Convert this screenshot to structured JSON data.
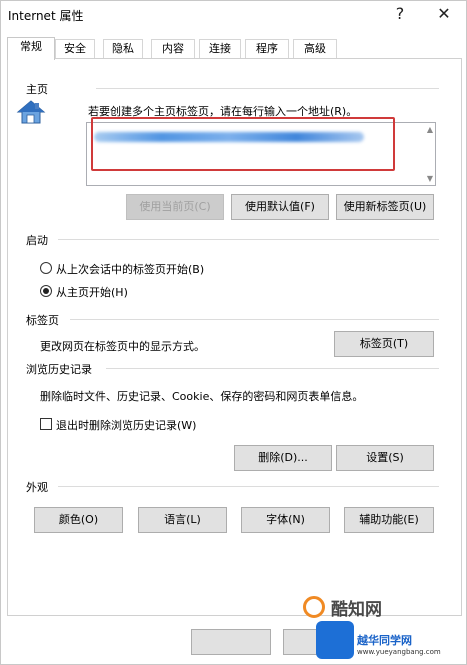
{
  "window": {
    "title": "Internet 属性",
    "help_glyph": "?",
    "close_glyph": "✕"
  },
  "tabs": [
    {
      "label": "常规",
      "active": true
    },
    {
      "label": "安全",
      "active": false
    },
    {
      "label": "隐私",
      "active": false
    },
    {
      "label": "内容",
      "active": false
    },
    {
      "label": "连接",
      "active": false
    },
    {
      "label": "程序",
      "active": false
    },
    {
      "label": "高级",
      "active": false
    }
  ],
  "homepage": {
    "section": "主页",
    "instruction": "若要创建多个主页标签页，请在每行输入一个地址(R)。",
    "use_current": "使用当前页(C)",
    "use_default": "使用默认值(F)",
    "use_new_tab": "使用新标签页(U)"
  },
  "startup": {
    "section": "启动",
    "option_last_session": "从上次会话中的标签页开始(B)",
    "option_home": "从主页开始(H)",
    "selected": "option_home"
  },
  "tabs_section": {
    "section": "标签页",
    "description": "更改网页在标签页中的显示方式。",
    "button": "标签页(T)"
  },
  "history": {
    "section": "浏览历史记录",
    "description": "删除临时文件、历史记录、Cookie、保存的密码和网页表单信息。",
    "checkbox_label": "退出时删除浏览历史记录(W)",
    "checked": false,
    "delete_button": "删除(D)...",
    "settings_button": "设置(S)"
  },
  "appearance": {
    "section": "外观",
    "colors": "颜色(O)",
    "languages": "语言(L)",
    "fonts": "字体(N)",
    "accessibility": "辅助功能(E)"
  },
  "watermark": {
    "brand1": "酷知网",
    "brand2": "越华同学网",
    "url": "www.yueyangbang.com"
  },
  "colors": {
    "accent_highlight": "#d03a3a",
    "button_bg": "#e1e1e1",
    "disabled_text": "#a0a0a0"
  }
}
